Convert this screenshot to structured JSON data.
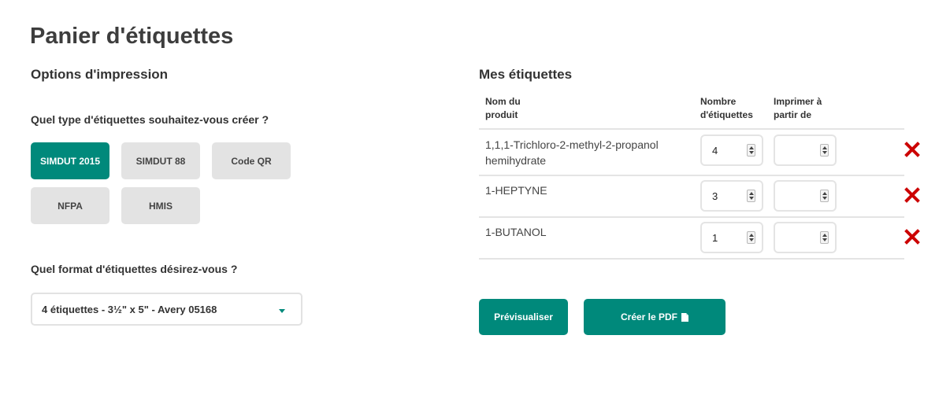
{
  "page": {
    "title": "Panier d'étiquettes"
  },
  "options": {
    "heading": "Options d'impression",
    "type_question": "Quel type d'étiquettes souhaitez-vous créer ?",
    "types": [
      {
        "label": "SIMDUT 2015",
        "active": true
      },
      {
        "label": "SIMDUT 88",
        "active": false
      },
      {
        "label": "Code QR",
        "active": false
      },
      {
        "label": "NFPA",
        "active": false
      },
      {
        "label": "HMIS",
        "active": false
      }
    ],
    "format_question": "Quel format d'étiquettes désirez-vous ?",
    "format_selected": "4 étiquettes - 3½\" x 5\" - Avery 05168"
  },
  "labels": {
    "heading": "Mes étiquettes",
    "columns": {
      "product_line1": "Nom du",
      "product_line2": "produit",
      "count_line1": "Nombre",
      "count_line2": "d'étiquettes",
      "start_line1": "Imprimer à",
      "start_line2": "partir de"
    },
    "rows": [
      {
        "name_line1": "1,1,1-Trichloro-2-methyl-2-propanol",
        "name_line2": "hemihydrate",
        "count": "4",
        "start": ""
      },
      {
        "name_line1": "1-HEPTYNE",
        "name_line2": "",
        "count": "3",
        "start": ""
      },
      {
        "name_line1": "1-BUTANOL",
        "name_line2": "",
        "count": "1",
        "start": ""
      }
    ]
  },
  "actions": {
    "preview_label": "Prévisualiser",
    "pdf_label": "Créer le PDF"
  },
  "colors": {
    "accent": "#00897b",
    "delete": "#cc0000",
    "button_inactive": "#e3e3e3"
  },
  "icons": {
    "delete": "close-x-icon",
    "pdf": "file-icon",
    "dropdown": "caret-down-icon"
  }
}
